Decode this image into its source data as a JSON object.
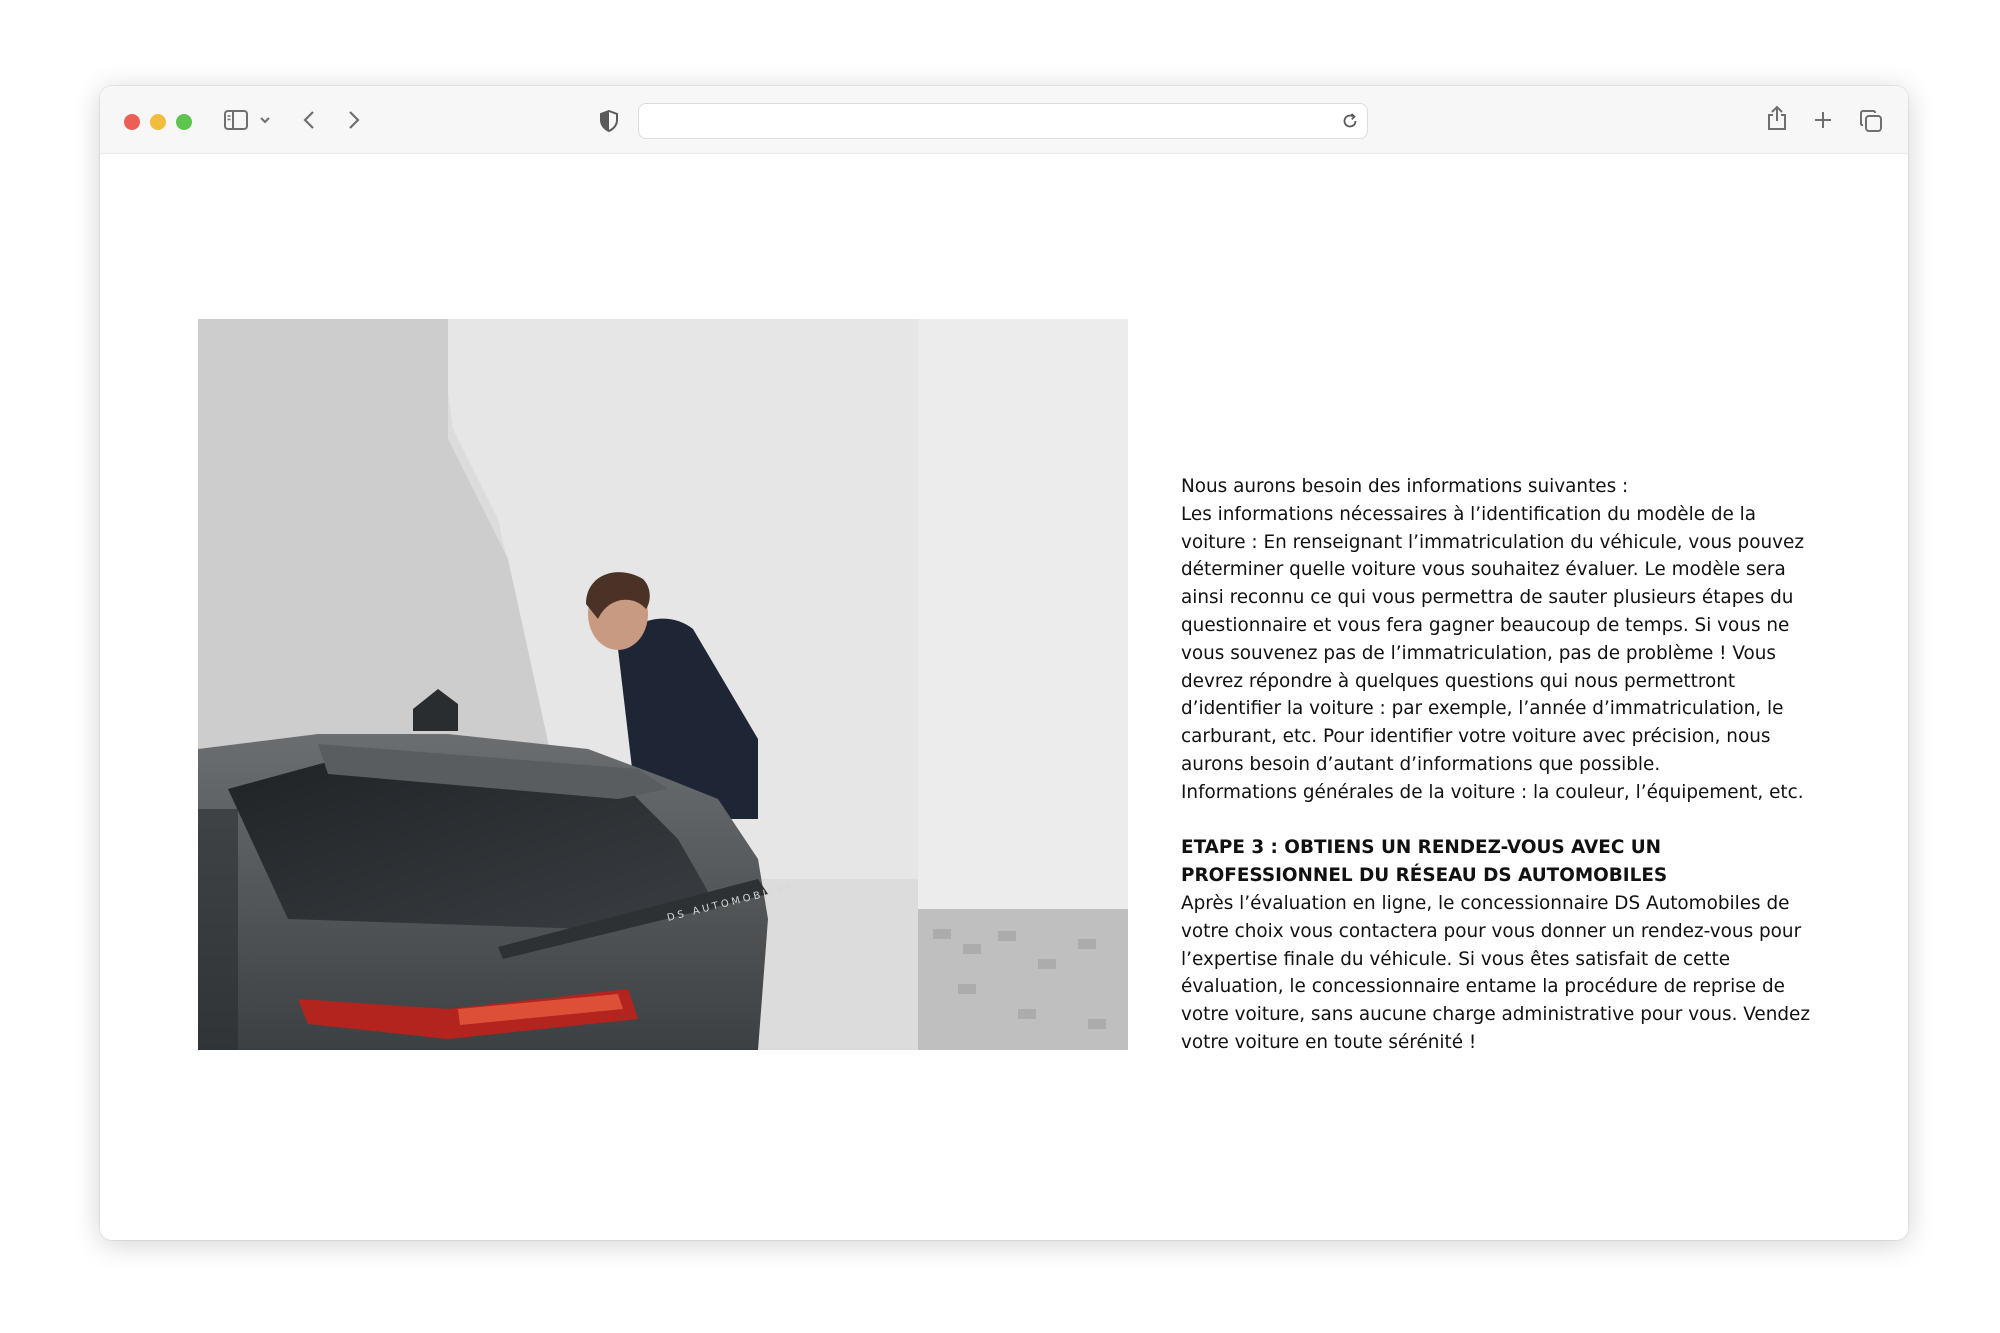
{
  "browser": {
    "address_value": "",
    "icons": {
      "sidebar": "sidebar-icon",
      "dropdown": "chevron-down-icon",
      "back": "chevron-left-icon",
      "forward": "chevron-right-icon",
      "privacy": "shield-icon",
      "reload": "reload-icon",
      "share": "share-icon",
      "new_tab": "plus-icon",
      "tabs": "tabs-icon"
    }
  },
  "article": {
    "intro": "Nous aurons besoin des informations suivantes :",
    "p1": "Les informations nécessaires à l’identification du modèle de la voiture : En renseignant l’immatriculation du véhicule, vous pouvez déterminer quelle voiture vous souhaitez évaluer. Le modèle sera ainsi reconnu ce qui vous permettra de sauter plusieurs étapes du questionnaire et vous fera gagner beaucoup de temps. Si vous ne vous souvenez pas de l’immatriculation, pas de problème ! Vous devrez répondre à quelques questions qui nous permettront d’identifier la voiture : par exemple, l’année d’immatriculation, le carburant, etc. Pour identifier votre voiture avec précision, nous aurons besoin d’autant d’informations que possible.",
    "p2": "Informations générales de la voiture : la couleur, l’équipement, etc.",
    "heading": "ETAPE 3 : OBTIENS UN RENDEZ-VOUS AVEC UN PROFESSIONNEL DU RÉSEAU DS AUTOMOBILES",
    "p3": "Après l’évaluation en ligne, le concessionnaire DS Automobiles de votre choix vous contactera pour vous donner un rendez-vous pour l’expertise finale du véhicule. Si vous êtes satisfait de cette évaluation, le concessionnaire entame la procédure de reprise de votre voiture, sans aucune charge administrative pour vous. Vendez votre voiture en toute sérénité !"
  },
  "photo": {
    "badge_text": "DS AUTOMOBILES"
  },
  "colors": {
    "traffic_red": "#ec5f57",
    "traffic_yellow": "#f2bd3e",
    "traffic_green": "#5fc350",
    "car_body": "#4a4d4f",
    "taillight": "#b3241f"
  }
}
